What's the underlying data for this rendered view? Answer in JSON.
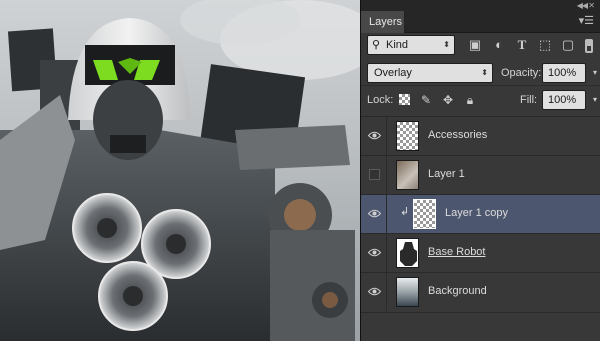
{
  "panel": {
    "tab_label": "Layers",
    "filter_kind": "Kind",
    "blend_mode": "Overlay",
    "opacity_label": "Opacity:",
    "opacity_value": "100%",
    "lock_label": "Lock:",
    "fill_label": "Fill:",
    "fill_value": "100%"
  },
  "layers": [
    {
      "name": "Accessories",
      "visible": true,
      "selected": false,
      "underline": false,
      "clipped": false
    },
    {
      "name": "Layer 1",
      "visible": false,
      "selected": false,
      "underline": false,
      "clipped": false
    },
    {
      "name": "Layer 1 copy",
      "visible": true,
      "selected": true,
      "underline": false,
      "clipped": true
    },
    {
      "name": "Base Robot",
      "visible": true,
      "selected": false,
      "underline": true,
      "clipped": false
    },
    {
      "name": "Background",
      "visible": true,
      "selected": false,
      "underline": false,
      "clipped": false
    }
  ],
  "icons": {
    "eye": "eye-icon",
    "search": "search-icon",
    "collapse": "collapse-arrows-icon",
    "menu": "panel-menu-icon"
  },
  "colors": {
    "selected_row": "#4c566e",
    "panel_bg": "#383838",
    "robot_eyes": "#7ddc1f"
  }
}
